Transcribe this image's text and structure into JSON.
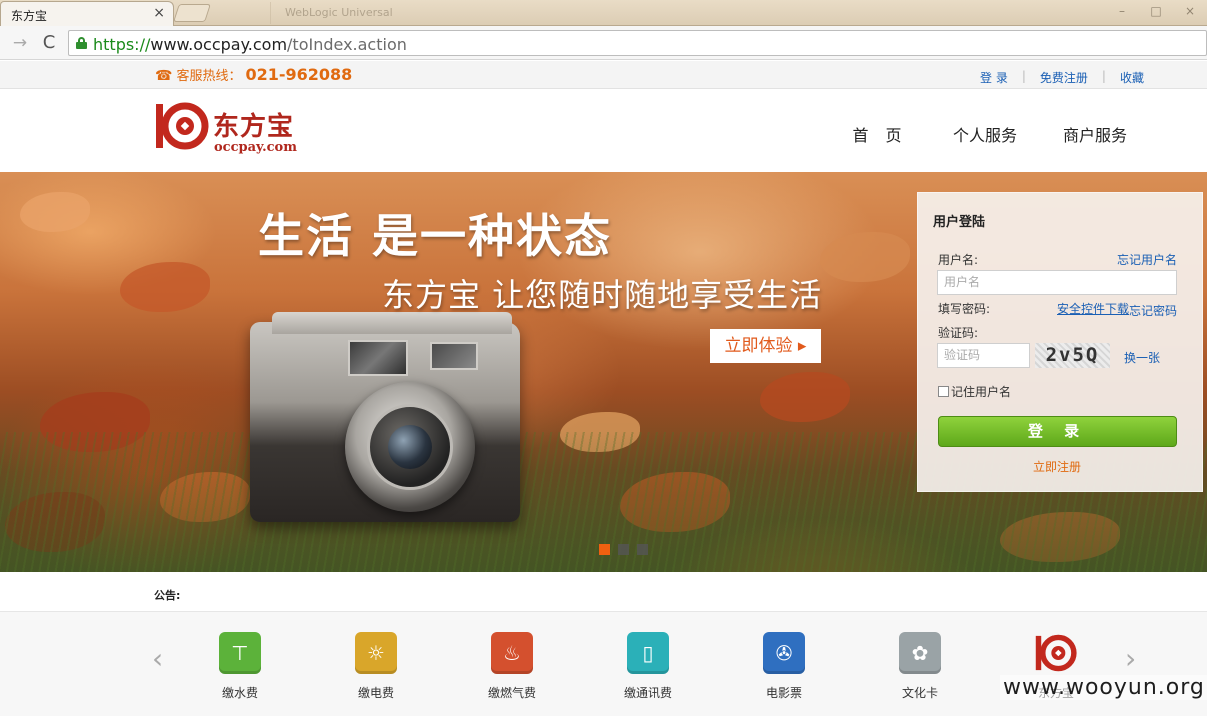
{
  "browser": {
    "tab_title": "东方宝",
    "tab_close": "×",
    "ghost_tab_title": "WebLogic Universal",
    "window_controls": [
      "–",
      "□",
      "×"
    ],
    "back_glyph": "→",
    "reload_glyph": "C",
    "url": {
      "scheme": "https://",
      "host": "www.occpay.com",
      "path": "/toIndex.action"
    }
  },
  "topbar": {
    "hotline_icon": "phone-icon",
    "hotline_label": "客服热线：",
    "hotline_number": "021-962088",
    "links": [
      "登 录",
      "免费注册",
      "收藏"
    ]
  },
  "header": {
    "logo_text": "东方宝",
    "logo_sub": "occpay.com",
    "nav": [
      "首 页",
      "个人服务",
      "商户服务"
    ]
  },
  "banner": {
    "headline": "生活  是一种状态",
    "subline": "东方宝  让您随时随地享受生活",
    "cta_label": "立即体验 ▸",
    "slides": 3,
    "active_slide": 1
  },
  "login": {
    "title": "用户登陆",
    "username_label": "用户名:",
    "forgot_username": "忘记用户名",
    "username_placeholder": "用户名",
    "password_label": "填写密码:",
    "download_control": "安全控件下载",
    "forgot_password": "忘记密码",
    "captcha_label": "验证码:",
    "captcha_placeholder": "验证码",
    "captcha_text": "2v5Q",
    "refresh_captcha": "换一张",
    "remember_label": "记住用户名",
    "login_button": "登 录",
    "register_link": "立即注册"
  },
  "notice": {
    "label": "公告:"
  },
  "services": {
    "prev_glyph": "‹",
    "next_glyph": "›",
    "items": [
      {
        "label": "缴水费",
        "icon": "water-tap-icon",
        "color": "#5cb23a",
        "glyph": "⊤"
      },
      {
        "label": "缴电费",
        "icon": "light-bulb-icon",
        "color": "#d9a62a",
        "glyph": "☼"
      },
      {
        "label": "缴燃气费",
        "icon": "flame-icon",
        "color": "#d4502e",
        "glyph": "♨"
      },
      {
        "label": "缴通讯费",
        "icon": "mobile-phone-icon",
        "color": "#2bb0b8",
        "glyph": "▯"
      },
      {
        "label": "电影票",
        "icon": "film-reel-icon",
        "color": "#2f6fc0",
        "glyph": "✇"
      },
      {
        "label": "文化卡",
        "icon": "culture-card-icon",
        "color": "#9aa3a6",
        "glyph": "✿"
      },
      {
        "label": "东方宝",
        "icon": "occpay-logo-icon",
        "color": "#c2281d",
        "glyph": ""
      }
    ]
  },
  "watermark": "www.wooyun.org"
}
